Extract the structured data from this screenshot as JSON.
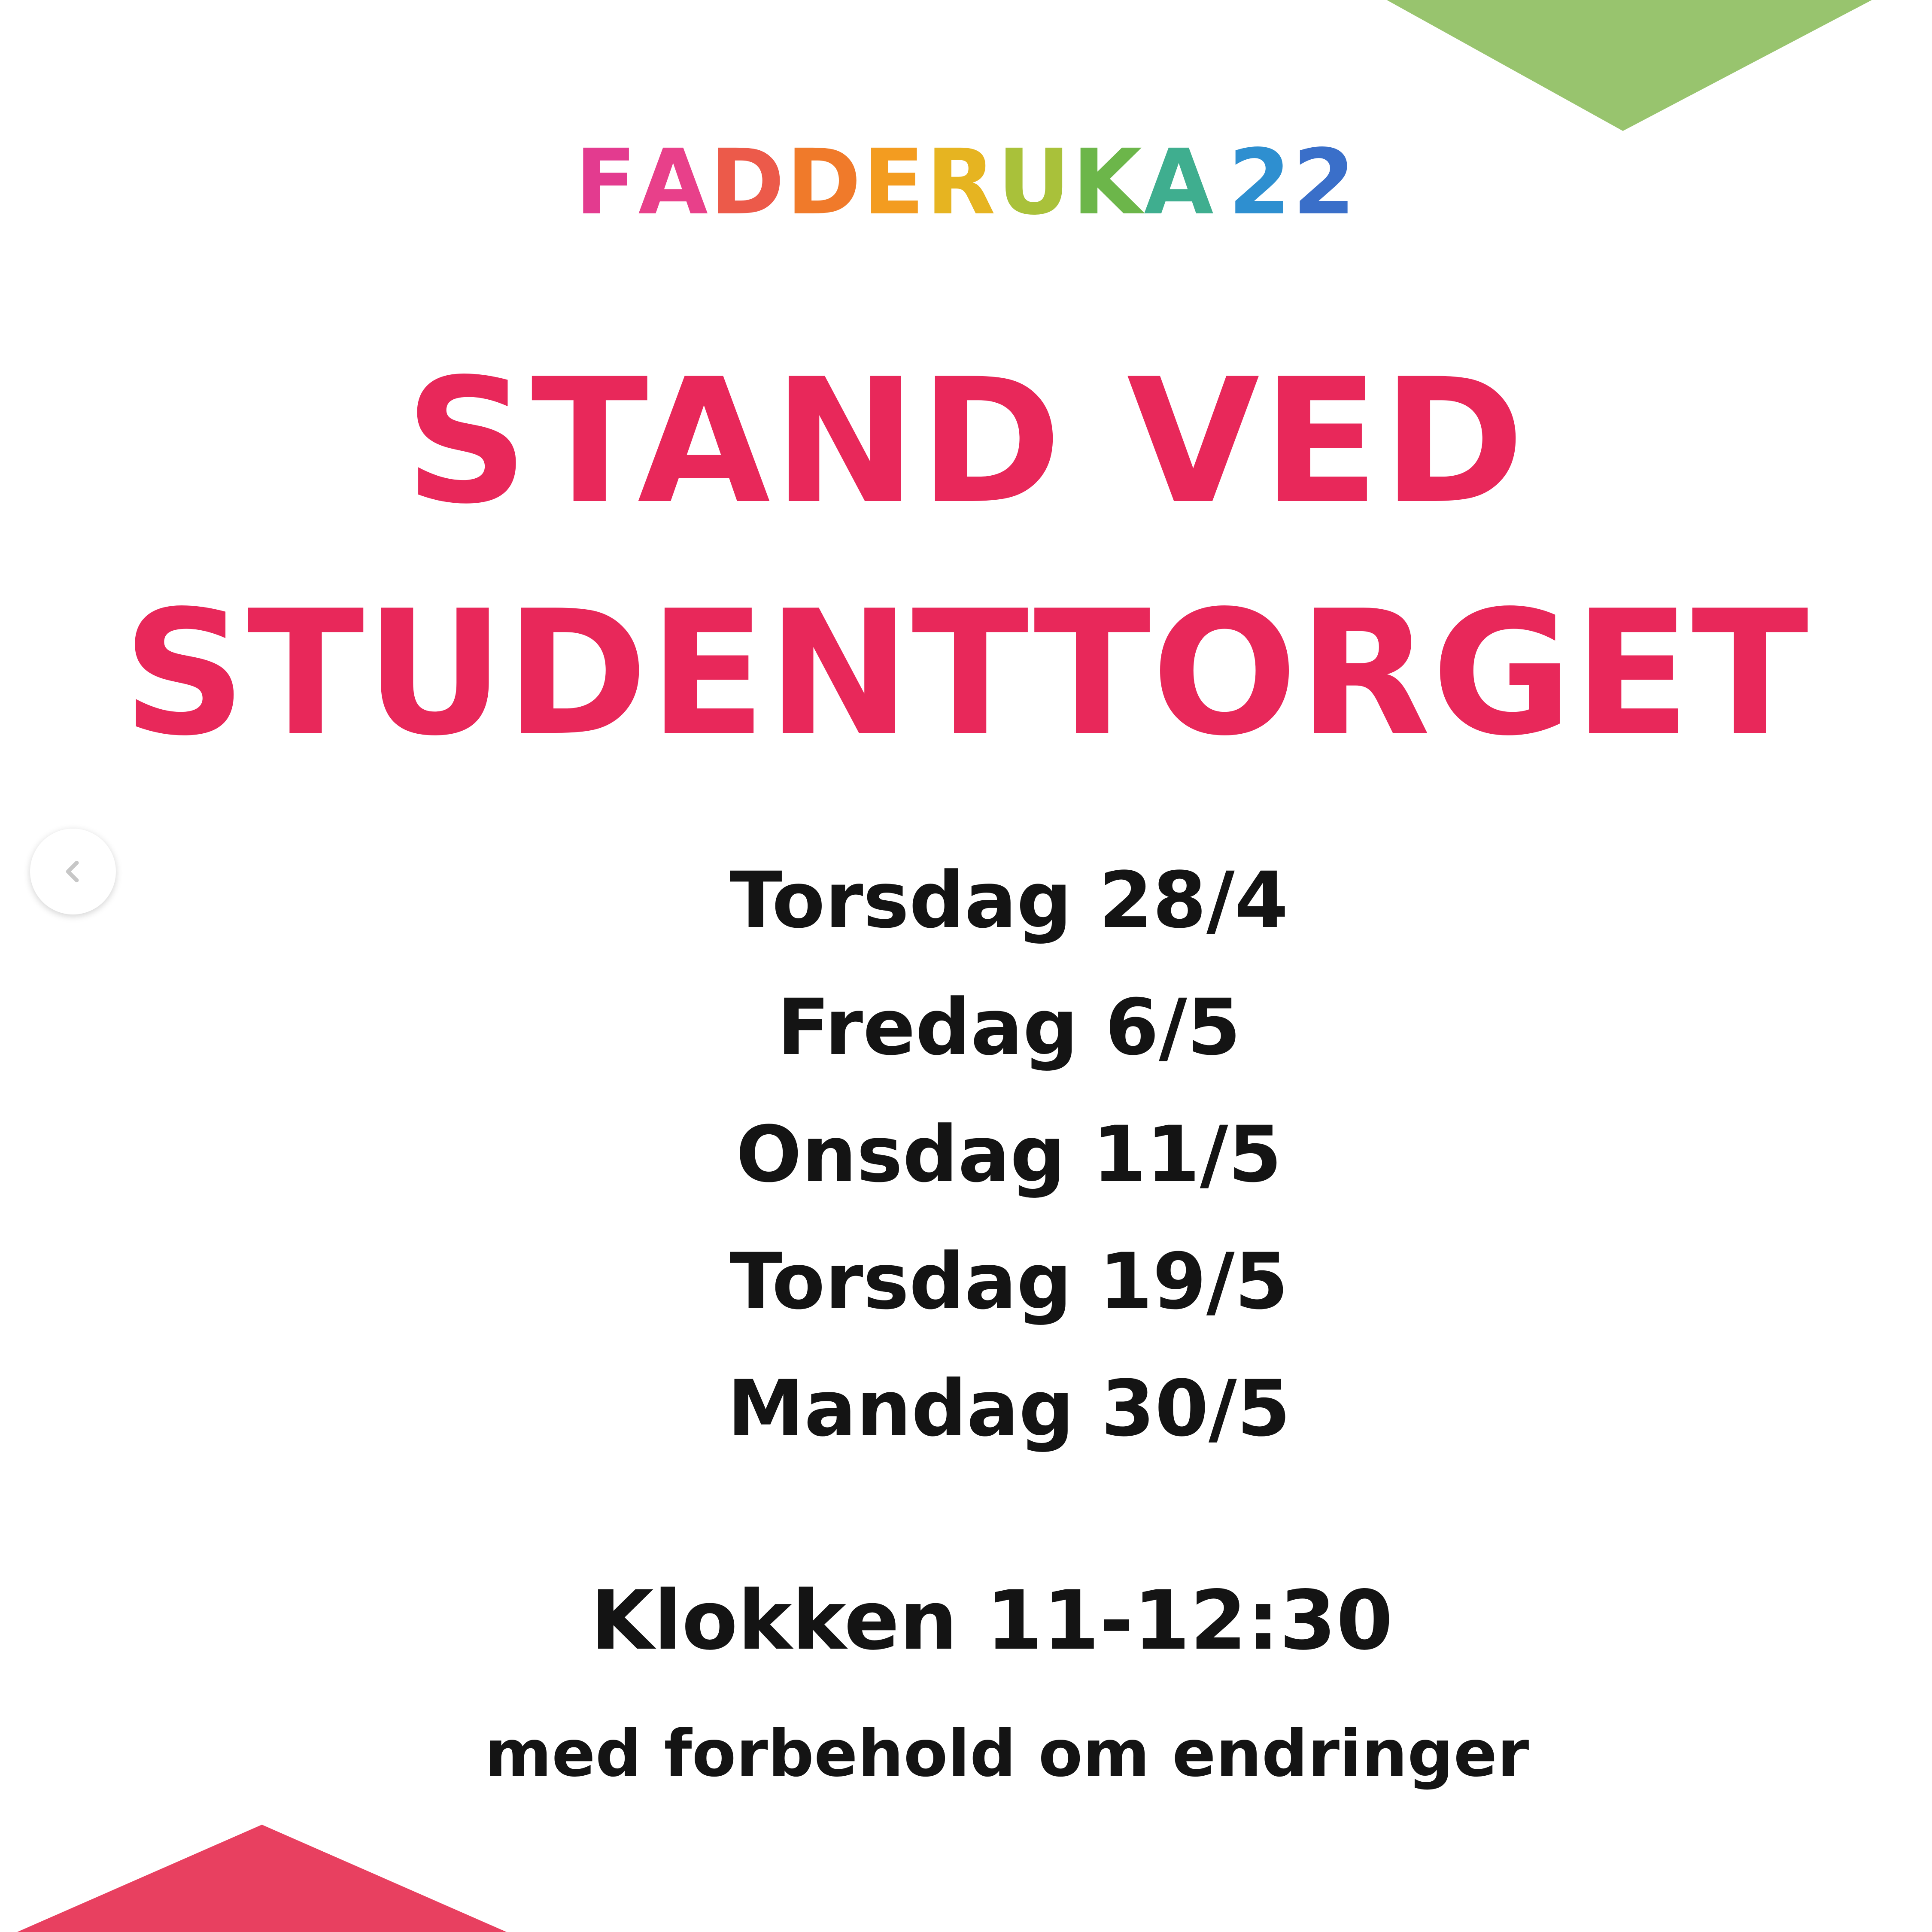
{
  "logo": {
    "letters": [
      {
        "char": "F",
        "color": "#e33b8f"
      },
      {
        "char": "A",
        "color": "#e8408a"
      },
      {
        "char": "D",
        "color": "#ec5a4a"
      },
      {
        "char": "D",
        "color": "#f07a2a"
      },
      {
        "char": "E",
        "color": "#f39c20"
      },
      {
        "char": "R",
        "color": "#e6b421"
      },
      {
        "char": "U",
        "color": "#a9c13a"
      },
      {
        "char": "K",
        "color": "#6cb64a"
      },
      {
        "char": "A",
        "color": "#3fae8f"
      },
      {
        "char": "2",
        "color": "#2e8fd0"
      },
      {
        "char": "2",
        "color": "#3a6fc9"
      }
    ]
  },
  "heading": {
    "line1": "STAND VED",
    "line2": "STUDENTTORGET"
  },
  "dates": [
    "Torsdag 28/4",
    "Fredag 6/5",
    "Onsdag 11/5",
    "Torsdag 19/5",
    "Mandag 30/5"
  ],
  "time": "Klokken 11-12:30",
  "disclaimer": "med forbehold om endringer",
  "navigation": {
    "prev_icon": "chevron-left-icon"
  },
  "colors": {
    "heading": "#e8285a",
    "body_text": "#141414",
    "green_accent": "#98c46e",
    "pink_accent": "#e84060",
    "background": "#ffffff"
  }
}
